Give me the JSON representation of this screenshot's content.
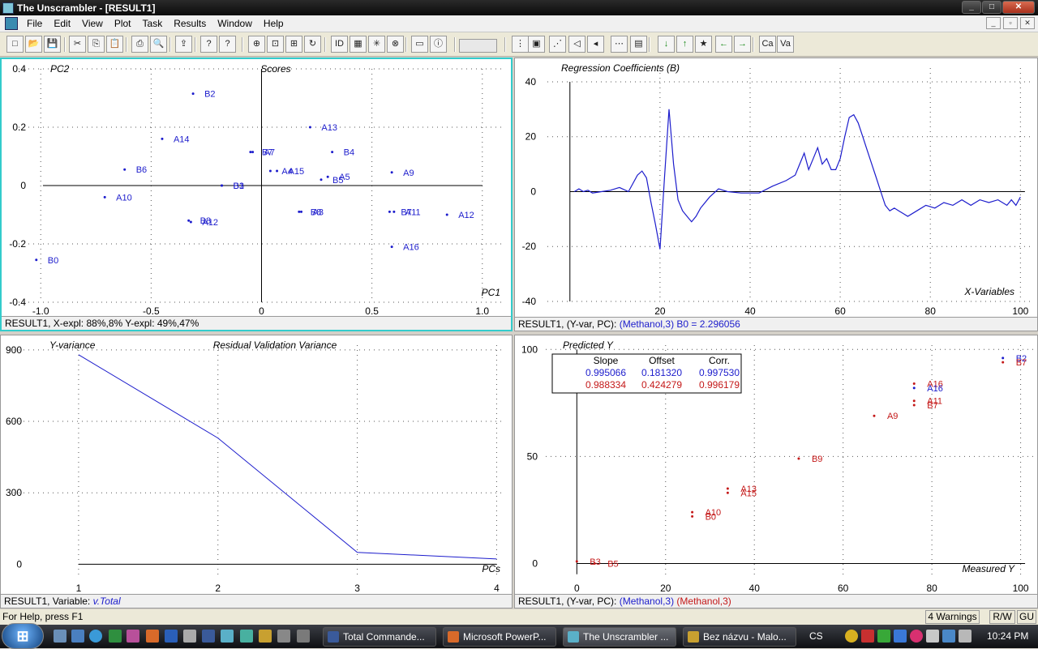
{
  "window": {
    "title": "The Unscrambler - [RESULT1]",
    "controls": [
      "_",
      "□",
      "✕"
    ]
  },
  "menu": [
    "File",
    "Edit",
    "View",
    "Plot",
    "Task",
    "Results",
    "Window",
    "Help"
  ],
  "mdi_controls": [
    "_",
    "▫",
    "✕"
  ],
  "toolbar_icons": [
    "new-file-icon",
    "open-folder-icon",
    "save-icon",
    "cut-icon",
    "copy-icon",
    "paste-icon",
    "print-icon",
    "print-preview-icon",
    "export-icon",
    "help-icon",
    "context-help-icon",
    "zoom-fit-icon",
    "zoom-frame-icon",
    "zoom-in-icon",
    "refresh-icon",
    "sample-id-icon",
    "grid-icon",
    "star-mark-icon",
    "crosshair-icon",
    "window-icon",
    "info-icon",
    "mark-one-icon",
    "mark-rect-icon",
    "mark-lasso-icon",
    "unmark-icon",
    "jump-icon",
    "mark-group-icon",
    "mark-range-icon",
    "down-arrow-icon",
    "up-arrow-icon",
    "star-icon",
    "left-arrow-icon",
    "right-arrow-icon",
    "calibrate-icon",
    "validate-icon"
  ],
  "panels": {
    "scores": {
      "status": "RESULT1, X-expl: 88%,8%  Y-expl: 49%,47%",
      "chart_data": {
        "type": "scatter",
        "title": "Scores",
        "xlabel": "PC1",
        "ylabel": "PC2",
        "xlim": [
          -1.1,
          1.1
        ],
        "ylim": [
          -0.4,
          0.4
        ],
        "xticks": [
          "-1.0",
          "-0.5",
          "0",
          "0.5",
          "1.0"
        ],
        "yticks": [
          "0.4",
          "0.2",
          "0",
          "-0.2",
          "-0.4"
        ],
        "points": [
          {
            "label": "B2",
            "x": -0.31,
            "y": 0.315
          },
          {
            "label": "A13",
            "x": 0.22,
            "y": 0.2
          },
          {
            "label": "A14",
            "x": -0.45,
            "y": 0.16
          },
          {
            "label": "B7",
            "x": -0.05,
            "y": 0.115
          },
          {
            "label": "A7",
            "x": -0.04,
            "y": 0.115
          },
          {
            "label": "B4",
            "x": 0.32,
            "y": 0.115
          },
          {
            "label": "B6",
            "x": -0.62,
            "y": 0.055
          },
          {
            "label": "A4",
            "x": 0.04,
            "y": 0.05
          },
          {
            "label": "A15",
            "x": 0.07,
            "y": 0.05
          },
          {
            "label": "A9",
            "x": 0.59,
            "y": 0.045
          },
          {
            "label": "B5",
            "x": 0.27,
            "y": 0.02
          },
          {
            "label": "A5",
            "x": 0.3,
            "y": 0.03
          },
          {
            "label": "B3",
            "x": -0.18,
            "y": 0.0
          },
          {
            "label": "B1",
            "x": -0.18,
            "y": 0.0
          },
          {
            "label": "A10",
            "x": -0.71,
            "y": -0.04
          },
          {
            "label": "A3",
            "x": 0.18,
            "y": -0.09
          },
          {
            "label": "B8",
            "x": 0.17,
            "y": -0.09
          },
          {
            "label": "B7",
            "x": 0.58,
            "y": -0.09
          },
          {
            "label": "A11",
            "x": 0.6,
            "y": -0.09
          },
          {
            "label": "A12",
            "x": 0.84,
            "y": -0.1
          },
          {
            "label": "B8",
            "x": -0.33,
            "y": -0.12
          },
          {
            "label": "A12",
            "x": -0.32,
            "y": -0.125
          },
          {
            "label": "A16",
            "x": 0.59,
            "y": -0.21
          },
          {
            "label": "B0",
            "x": -1.02,
            "y": -0.255
          }
        ]
      }
    },
    "regression": {
      "status_prefix": "RESULT1, (Y-var, PC): ",
      "status_blue": "(Methanol,3) B0 = 2.296056",
      "chart_data": {
        "type": "line",
        "title": "Regression Coefficients (B)",
        "xlabel": "X-Variables",
        "ylabel": "",
        "xlim": [
          -5,
          103
        ],
        "ylim": [
          -40,
          45
        ],
        "xticks": [
          "20",
          "40",
          "60",
          "80",
          "100"
        ],
        "yticks": [
          "40",
          "20",
          "0",
          "-20",
          "-40"
        ],
        "series": [
          {
            "values": [
              [
                1,
                0
              ],
              [
                2,
                1
              ],
              [
                3,
                0
              ],
              [
                4,
                0.5
              ],
              [
                5,
                -0.5
              ],
              [
                7,
                0
              ],
              [
                9,
                0.5
              ],
              [
                11,
                1.5
              ],
              [
                13,
                0
              ],
              [
                15,
                6
              ],
              [
                16,
                7.5
              ],
              [
                17,
                5
              ],
              [
                18,
                -4
              ],
              [
                19,
                -12
              ],
              [
                20,
                -21
              ],
              [
                21,
                5
              ],
              [
                22,
                30
              ],
              [
                23,
                10
              ],
              [
                24,
                -3
              ],
              [
                25,
                -7
              ],
              [
                26,
                -9
              ],
              [
                27,
                -11
              ],
              [
                28,
                -9
              ],
              [
                29,
                -6
              ],
              [
                31,
                -2
              ],
              [
                33,
                1
              ],
              [
                35,
                0
              ],
              [
                38,
                -0.5
              ],
              [
                42,
                -0.5
              ],
              [
                45,
                2
              ],
              [
                48,
                4
              ],
              [
                50,
                6
              ],
              [
                51,
                10
              ],
              [
                52,
                14
              ],
              [
                53,
                8
              ],
              [
                54,
                12
              ],
              [
                55,
                16
              ],
              [
                56,
                10
              ],
              [
                57,
                12
              ],
              [
                58,
                8
              ],
              [
                59,
                8
              ],
              [
                60,
                12
              ],
              [
                61,
                20
              ],
              [
                62,
                27
              ],
              [
                63,
                28
              ],
              [
                64,
                25
              ],
              [
                65,
                20
              ],
              [
                66,
                15
              ],
              [
                67,
                10
              ],
              [
                68,
                5
              ],
              [
                69,
                0
              ],
              [
                70,
                -5
              ],
              [
                71,
                -7
              ],
              [
                72,
                -6
              ],
              [
                73,
                -7
              ],
              [
                74,
                -8
              ],
              [
                75,
                -9
              ],
              [
                77,
                -7
              ],
              [
                79,
                -5
              ],
              [
                81,
                -6
              ],
              [
                83,
                -4
              ],
              [
                85,
                -5
              ],
              [
                87,
                -3
              ],
              [
                89,
                -5
              ],
              [
                91,
                -3
              ],
              [
                93,
                -4
              ],
              [
                95,
                -3
              ],
              [
                97,
                -5
              ],
              [
                98,
                -3
              ],
              [
                99,
                -5
              ],
              [
                100,
                -2
              ]
            ]
          }
        ]
      }
    },
    "residual": {
      "status_prefix": "RESULT1, Variable:  ",
      "status_blue": "v.Total",
      "chart_data": {
        "type": "line",
        "title": "Residual Validation Variance",
        "xlabel": "PCs",
        "ylabel": "Y-variance",
        "xlim": [
          0.5,
          4.05
        ],
        "ylim": [
          -60,
          920
        ],
        "xticks": [
          "1",
          "2",
          "3",
          "4"
        ],
        "yticks": [
          "900",
          "600",
          "300",
          "0"
        ],
        "series": [
          {
            "values": [
              [
                1,
                880
              ],
              [
                2,
                530
              ],
              [
                3,
                50
              ],
              [
                4,
                22
              ]
            ]
          }
        ]
      }
    },
    "predicted": {
      "status_prefix": "RESULT1, (Y-var, PC): ",
      "status_blue": "(Methanol,3)",
      "status_red": "(Methanol,3)",
      "stats": {
        "headers": [
          "Slope",
          "Offset",
          "Corr."
        ],
        "rows": [
          [
            "0.995066",
            "0.181320",
            "0.997530"
          ],
          [
            "0.988334",
            "0.424279",
            "0.996179"
          ]
        ]
      },
      "chart_data": {
        "type": "scatter",
        "title": "",
        "xlabel": "Measured Y",
        "ylabel": "Predicted Y",
        "xlim": [
          -7,
          103
        ],
        "ylim": [
          -7,
          102
        ],
        "xticks": [
          "0",
          "20",
          "40",
          "60",
          "80",
          "100"
        ],
        "yticks": [
          "100",
          "50",
          "0"
        ],
        "points": [
          {
            "label": "B2",
            "x": 96,
            "y": 96,
            "color": "blue"
          },
          {
            "label": "B7",
            "x": 96,
            "y": 94,
            "color": "red"
          },
          {
            "label": "A16",
            "x": 76,
            "y": 84,
            "color": "red"
          },
          {
            "label": "A16",
            "x": 76,
            "y": 82,
            "color": "blue"
          },
          {
            "label": "A11",
            "x": 76,
            "y": 76,
            "color": "red"
          },
          {
            "label": "B7",
            "x": 76,
            "y": 74,
            "color": "red"
          },
          {
            "label": "A9",
            "x": 67,
            "y": 69,
            "color": "red"
          },
          {
            "label": "B9",
            "x": 50,
            "y": 49,
            "color": "red"
          },
          {
            "label": "A13",
            "x": 34,
            "y": 35,
            "color": "red"
          },
          {
            "label": "A15",
            "x": 34,
            "y": 33,
            "color": "red"
          },
          {
            "label": "A10",
            "x": 26,
            "y": 24,
            "color": "red"
          },
          {
            "label": "B0",
            "x": 26,
            "y": 22,
            "color": "red"
          },
          {
            "label": "B3",
            "x": 0,
            "y": 1,
            "color": "red"
          },
          {
            "label": "B5",
            "x": 4,
            "y": 0,
            "color": "red"
          }
        ]
      }
    }
  },
  "status": {
    "help": "For Help, press F1",
    "warnings": "4 Warnings",
    "rw": "R/W",
    "gu": "GU"
  },
  "taskbar": {
    "tasks": [
      "Total Commande...",
      "Microsoft PowerP...",
      "The Unscrambler ...",
      "Bez názvu - Malo..."
    ],
    "lang": "CS",
    "clock": "10:24 PM"
  }
}
